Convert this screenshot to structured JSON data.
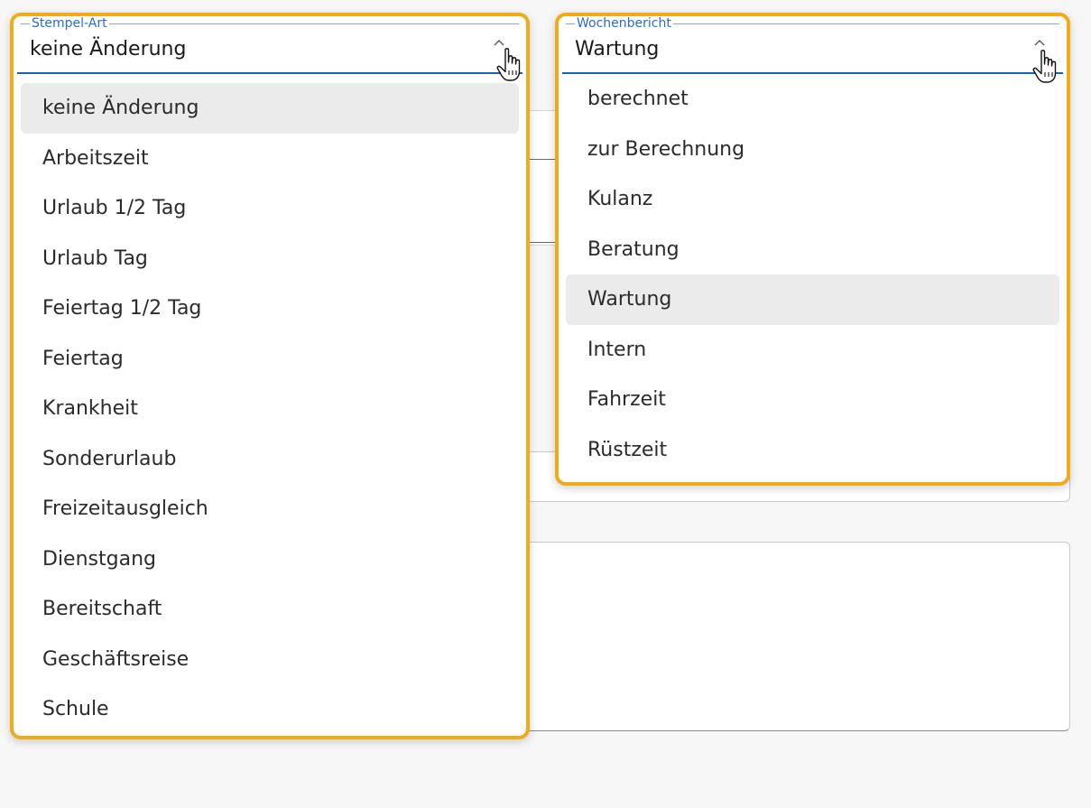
{
  "stempel": {
    "legend": "Stempel-Art",
    "value": "keine Änderung",
    "selected_index": 0,
    "options": [
      "keine Änderung",
      "Arbeitszeit",
      "Urlaub 1/2 Tag",
      "Urlaub Tag",
      "Feiertag 1/2 Tag",
      "Feiertag",
      "Krankheit",
      "Sonderurlaub",
      "Freizeitausgleich",
      "Dienstgang",
      "Bereitschaft",
      "Geschäftsreise",
      "Schule"
    ]
  },
  "wochenbericht": {
    "legend": "Wochenbericht",
    "value": "Wartung",
    "selected_index": 4,
    "options": [
      "berechnet",
      "zur Berechnung",
      "Kulanz",
      "Beratung",
      "Wartung",
      "Intern",
      "Fahrzeit",
      "Rüstzeit"
    ]
  },
  "colors": {
    "highlight_border": "#f0ab1a",
    "accent": "#1f5fb5",
    "legend_text": "#2a6bd1",
    "selected_bg": "#ebebeb"
  },
  "icons": {
    "chevron": "chevron-up-icon",
    "cursor": "hand-pointer-cursor-icon"
  }
}
